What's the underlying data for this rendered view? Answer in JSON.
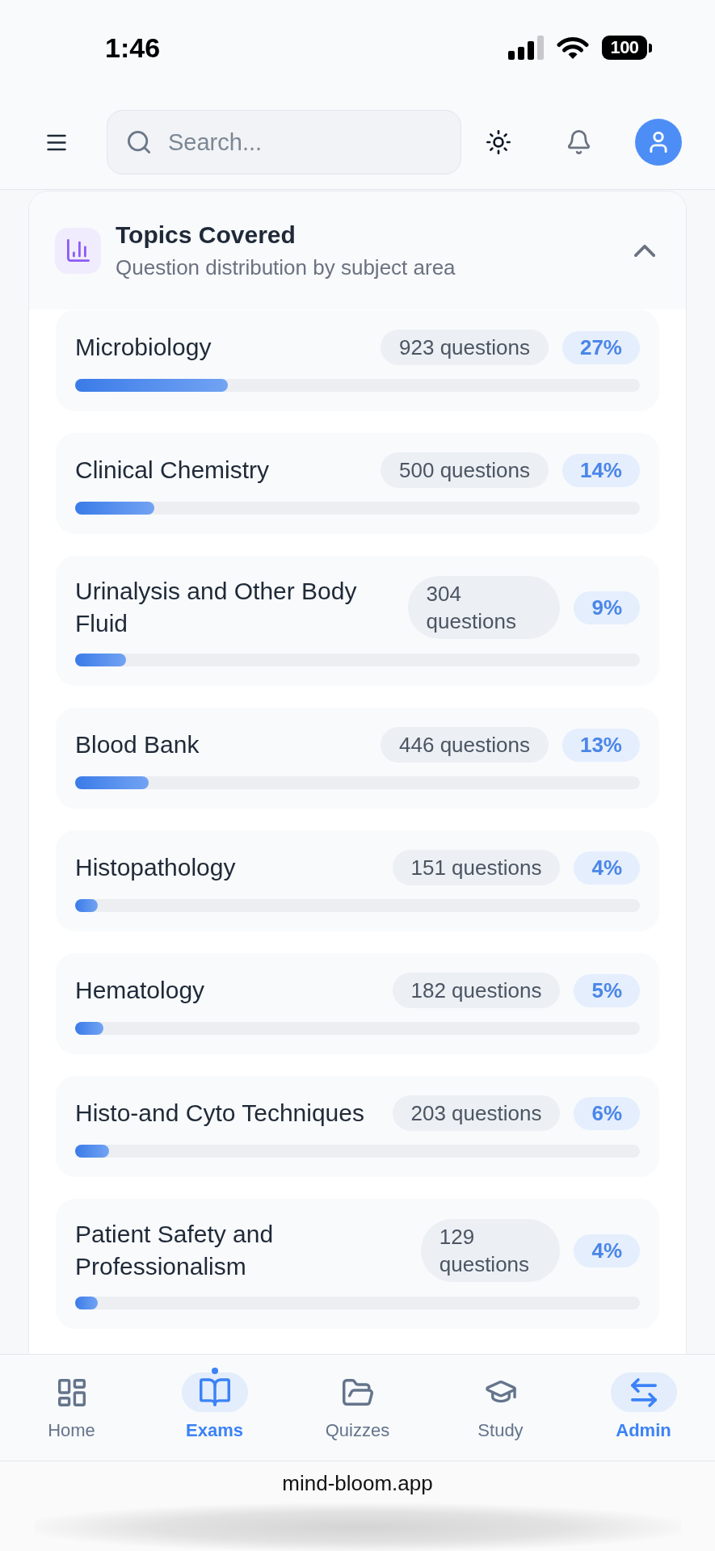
{
  "status_bar": {
    "time": "1:46",
    "battery": "100"
  },
  "header": {
    "search": {
      "placeholder": "Search..."
    }
  },
  "topics_card": {
    "title": "Topics Covered",
    "subtitle": "Question distribution by subject area",
    "expanded": true,
    "topics": [
      {
        "name": "Microbiology",
        "count": "923 questions",
        "percent": "27%",
        "level": 0.27
      },
      {
        "name": "Clinical Chemistry",
        "count": "500 questions",
        "percent": "14%",
        "level": 0.14
      },
      {
        "name": "Urinalysis and Other Body Fluid",
        "count": "304 questions",
        "percent": "9%",
        "level": 0.09
      },
      {
        "name": "Blood Bank",
        "count": "446 questions",
        "percent": "13%",
        "level": 0.13
      },
      {
        "name": "Histopathology",
        "count": "151 questions",
        "percent": "4%",
        "level": 0.04
      },
      {
        "name": "Hematology",
        "count": "182 questions",
        "percent": "5%",
        "level": 0.05
      },
      {
        "name": "Histo-and Cyto Techniques",
        "count": "203 questions",
        "percent": "6%",
        "level": 0.06
      },
      {
        "name": "Patient Safety and Professionalism",
        "count": "129 questions",
        "percent": "4%",
        "level": 0.04
      }
    ]
  },
  "bottom_nav": {
    "items": [
      {
        "label": "Home",
        "selected": false,
        "dot": false
      },
      {
        "label": "Exams",
        "selected": true,
        "dot": true
      },
      {
        "label": "Quizzes",
        "selected": false,
        "dot": false
      },
      {
        "label": "Study",
        "selected": false,
        "dot": false
      },
      {
        "label": "Admin",
        "selected": true,
        "dot": false
      }
    ]
  },
  "browser": {
    "url": "mind-bloom.app"
  }
}
